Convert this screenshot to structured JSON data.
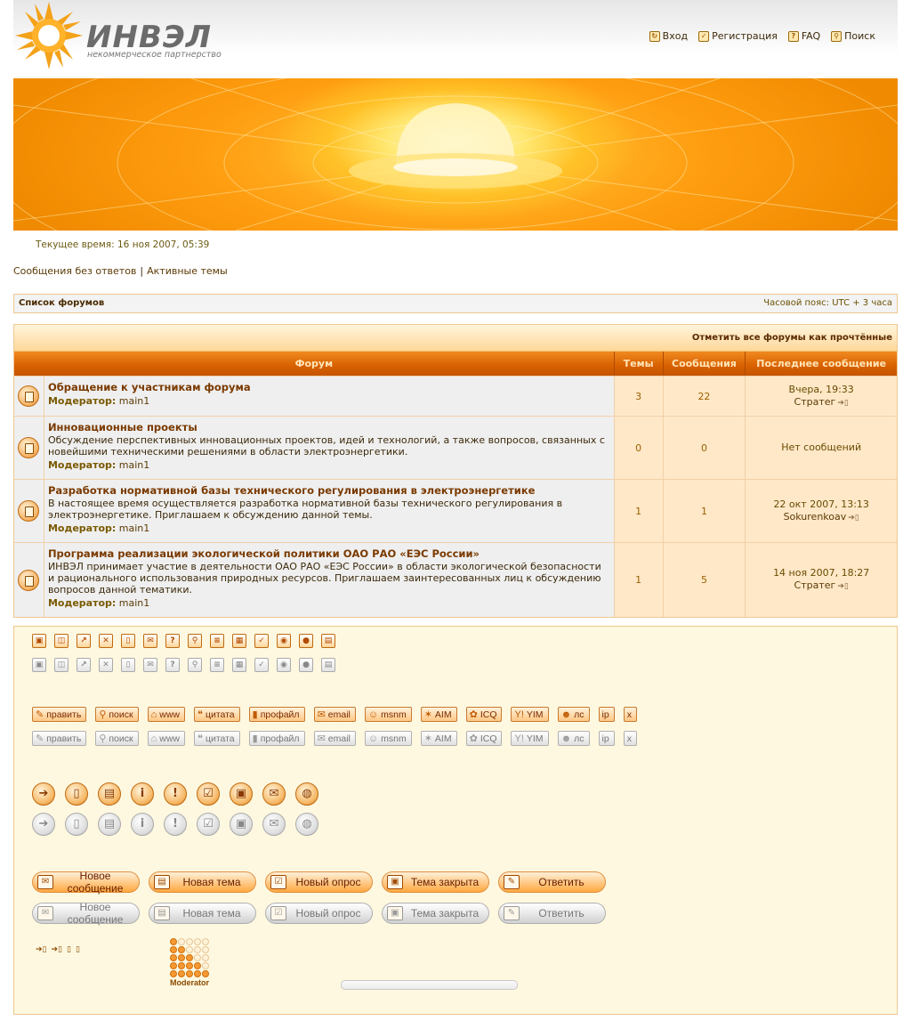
{
  "logo": {
    "name": "ИНВЭЛ",
    "subtitle": "некоммерческое партнерство"
  },
  "topnav": [
    {
      "label": "Вход",
      "icon": "login-icon"
    },
    {
      "label": "Регистрация",
      "icon": "register-icon"
    },
    {
      "label": "FAQ",
      "icon": "faq-icon"
    },
    {
      "label": "Поиск",
      "icon": "search-icon"
    }
  ],
  "current_time": "Текущее время: 16 ноя 2007, 05:39",
  "quicklinks": {
    "unanswered": "Сообщения без ответов",
    "separator": "|",
    "active": "Активные темы"
  },
  "breadcrumb": {
    "home": "Список форумов",
    "timezone": "Часовой пояс: UTC + 3 часа"
  },
  "forum_table": {
    "mark_read": "Отметить все форумы как прочтённые",
    "columns": {
      "forum": "Форум",
      "topics": "Темы",
      "posts": "Сообщения",
      "last_post": "Последнее сообщение"
    },
    "rows": [
      {
        "title": "Обращение к участникам форума",
        "desc": "",
        "mod_label": "Модератор:",
        "mod": "main1",
        "topics": "3",
        "posts": "22",
        "last_date": "Вчера, 19:33",
        "last_user": "Стратег"
      },
      {
        "title": "Инновационные проекты",
        "desc": "Обсуждение перспективных инновационных проектов, идей и технологий, а также вопросов, связанных с новейшими техническими решениями в области электроэнергетики.",
        "mod_label": "Модератор:",
        "mod": "main1",
        "topics": "0",
        "posts": "0",
        "last_date": "Нет сообщений",
        "last_user": ""
      },
      {
        "title": "Разработка нормативной базы технического регулирования в электроэнергетике",
        "desc": "В настоящее время осуществляется разработка нормативной базы технического регулирования в электроэнергетике. Приглашаем к обсуждению данной темы.",
        "mod_label": "Модератор:",
        "mod": "main1",
        "topics": "1",
        "posts": "1",
        "last_date": "22 окт 2007, 13:13",
        "last_user": "Sokurenkoav"
      },
      {
        "title": "Программа реализации экологической политики ОАО РАО «ЕЭС России»",
        "desc": "ИНВЭЛ принимает участие в деятельности ОАО РАО «ЕЭС России» в области экологической безопасности и рационального использования природных ресурсов. Приглашаем заинтересованных лиц к обсуждению вопросов данной тематики.",
        "mod_label": "Модератор:",
        "mod": "main1",
        "topics": "1",
        "posts": "5",
        "last_date": "14 ноя 2007, 18:27",
        "last_user": "Стратег"
      }
    ]
  },
  "icon_row": [
    "lock-icon",
    "unlock-icon",
    "move-icon",
    "delete-icon",
    "page-icon",
    "mail-icon",
    "help-icon",
    "search-icon",
    "list-icon",
    "calc-icon",
    "check-icon",
    "shield-icon",
    "user-icon",
    "book-icon"
  ],
  "small_buttons": [
    {
      "label": "править",
      "icon": "edit-icon"
    },
    {
      "label": "поиск",
      "icon": "search-icon"
    },
    {
      "label": "www",
      "icon": "home-icon"
    },
    {
      "label": "цитата",
      "icon": "quote-icon"
    },
    {
      "label": "профайл",
      "icon": "profile-icon"
    },
    {
      "label": "email",
      "icon": "email-icon"
    },
    {
      "label": "msnm",
      "icon": "msn-icon"
    },
    {
      "label": "AIM",
      "icon": "aim-icon"
    },
    {
      "label": "ICQ",
      "icon": "icq-icon"
    },
    {
      "label": "YIM",
      "icon": "yahoo-icon"
    },
    {
      "label": "лс",
      "icon": "pm-icon"
    },
    {
      "label": "ip",
      "icon": ""
    },
    {
      "label": "x",
      "icon": ""
    }
  ],
  "circle_icons": [
    "arrow-icon",
    "page-icon",
    "pages-icon",
    "info-icon",
    "alert-icon",
    "check-icon",
    "lock-icon",
    "mail-icon",
    "globe-icon"
  ],
  "big_buttons": [
    {
      "label": "Новое сообщение",
      "icon": "mail-icon"
    },
    {
      "label": "Новая тема",
      "icon": "topic-icon"
    },
    {
      "label": "Новый опрос",
      "icon": "poll-icon"
    },
    {
      "label": "Тема закрыта",
      "icon": "lock-icon"
    },
    {
      "label": "Ответить",
      "icon": "reply-icon"
    }
  ],
  "rank_label": "Moderator",
  "colors": {
    "accent": "#d86000",
    "row_bg": "#efefef",
    "stat_bg": "#ffe8c8",
    "panel_bg": "#fff8e0",
    "border": "#f0c890"
  }
}
